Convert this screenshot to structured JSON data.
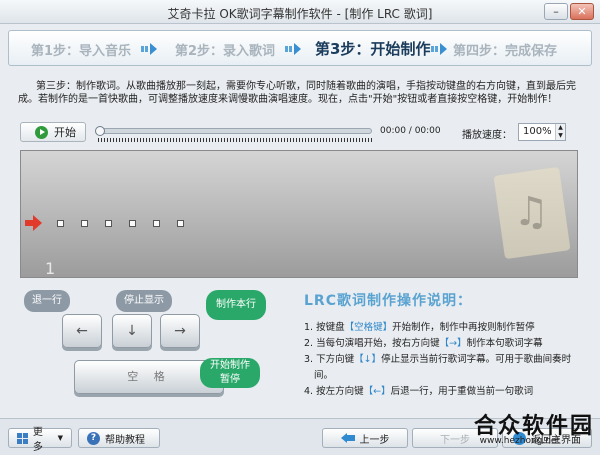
{
  "window": {
    "title": "艾奇卡拉 OK歌词字幕制作软件 - [制作 LRC 歌词]",
    "minimize": "–",
    "close": "✕"
  },
  "steps": [
    {
      "label": "第1步：导入音乐",
      "active": false
    },
    {
      "label": "第2步：录入歌词",
      "active": false
    },
    {
      "label": "第3步：开始制作",
      "active": true
    },
    {
      "label": "第四步：完成保存",
      "active": false
    }
  ],
  "intro": "第三步：制作歌词。从歌曲播放那一刻起，需要你专心听歌，同时随着歌曲的演唱，手指按动键盘的右方向键，直到最后完成。若制作的是一首快歌曲，可调整播放速度来调慢歌曲演唱速度。现在，点击\"开始\"按钮或者直接按空格键，开始制作！",
  "player": {
    "play_label": "开始",
    "time": "00:00 / 00:00",
    "speed_label": "播放速度：",
    "speed_value": "100%",
    "progress": 0
  },
  "lyrics": {
    "line_number": "1",
    "dot_count": 6
  },
  "keyboard": {
    "left_key": "←",
    "down_key": "↓",
    "right_key": "→",
    "space_key": "空 格",
    "tip_prev": "退一行",
    "tip_stop": "停止显示",
    "tip_make": "制作本行",
    "tip_start_line1": "开始制作",
    "tip_start_line2": "暂停"
  },
  "help": {
    "title": "LRC歌词制作操作说明：",
    "items": [
      {
        "prefix": "1. 按键盘",
        "key": "【空格键】",
        "suffix": "开始制作，制作中再按则制作暂停"
      },
      {
        "prefix": "2. 当每句演唱开始，按右方向键",
        "key": "【→】",
        "suffix": "制作本句歌词字幕"
      },
      {
        "prefix": "3. 下方向键",
        "key": "【↓】",
        "suffix": "停止显示当前行歌词字幕。可用于歌曲间奏时间。"
      },
      {
        "prefix": "4. 按左方向键",
        "key": "【←】",
        "suffix": "后退一行，用于重做当前一句歌词"
      }
    ]
  },
  "footer": {
    "more": "更多",
    "help": "帮助教程",
    "prev": "上一步",
    "next": "下一步",
    "home": "返回主界面"
  },
  "watermark": {
    "text": "合众软件园",
    "url": "www.hezhong.net"
  },
  "colors": {
    "accent": "#2f86c9",
    "tip_green": "#2aa86a",
    "cursor_red": "#e23a2a"
  }
}
